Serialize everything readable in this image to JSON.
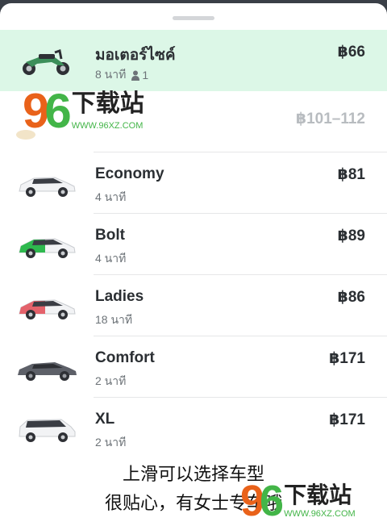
{
  "rides": [
    {
      "id": "moto",
      "name": "มอเตอร์ไซค์",
      "eta": "8 นาที",
      "seats": "1",
      "price": "฿66",
      "selected": true,
      "color": "#2e3035"
    },
    {
      "id": "partial",
      "name": "",
      "eta": "",
      "price": "฿101–112",
      "selected": false
    },
    {
      "id": "economy",
      "name": "Economy",
      "eta": "4 นาที",
      "price": "฿81",
      "color": "#f2f3f5"
    },
    {
      "id": "bolt",
      "name": "Bolt",
      "eta": "4 นาที",
      "price": "฿89",
      "color": "#2eb94e"
    },
    {
      "id": "ladies",
      "name": "Ladies",
      "eta": "18 นาที",
      "price": "฿86",
      "color": "#e4626b"
    },
    {
      "id": "comfort",
      "name": "Comfort",
      "eta": "2 นาที",
      "price": "฿171",
      "color": "#5d6068"
    },
    {
      "id": "xl",
      "name": "XL",
      "eta": "2 นาที",
      "price": "฿171",
      "color": "#f2f3f5"
    }
  ],
  "watermark": {
    "digits_9": "9",
    "digits_6": "6",
    "title": "下载站",
    "url": "WWW.96XZ.COM"
  },
  "caption": {
    "line1": "上滑可以选择车型",
    "line2": "很贴心，有女士专车哦"
  },
  "colors": {
    "selected_bg": "#dcf7e7",
    "brand_green": "#2eb94e"
  }
}
